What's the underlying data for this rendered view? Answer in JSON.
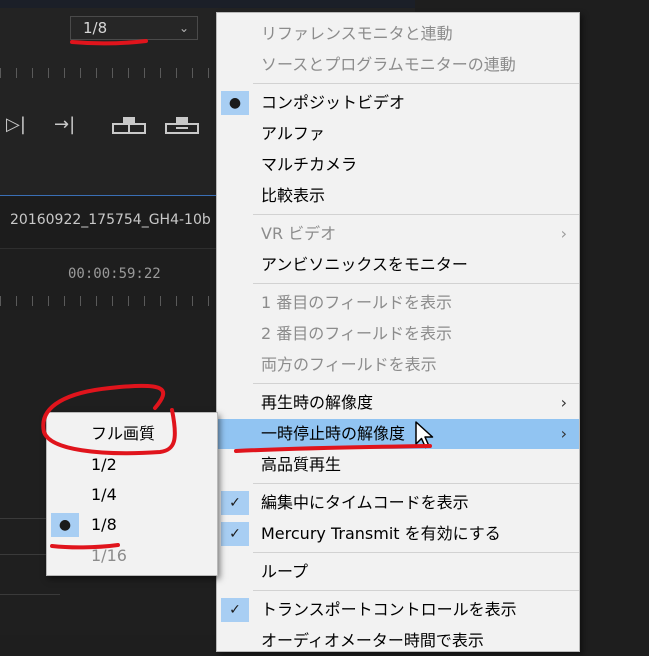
{
  "monitor": {
    "zoom_value": "1/8",
    "clip_name": "20160922_175754_GH4-10b",
    "timecode": "00:00:59:22"
  },
  "context_menu": {
    "items": [
      {
        "label": "リファレンスモニタと連動",
        "disabled": true
      },
      {
        "label": "ソースとプログラムモニターの連動",
        "disabled": true
      },
      {
        "label": "コンポジットビデオ",
        "mark": "●"
      },
      {
        "label": "アルファ"
      },
      {
        "label": "マルチカメラ"
      },
      {
        "label": "比較表示"
      },
      {
        "label": "VR ビデオ",
        "disabled": true,
        "submenu": true
      },
      {
        "label": "アンビソニックスをモニター"
      },
      {
        "label": "1 番目のフィールドを表示",
        "disabled": true
      },
      {
        "label": "2 番目のフィールドを表示",
        "disabled": true
      },
      {
        "label": "両方のフィールドを表示",
        "disabled": true
      },
      {
        "label": "再生時の解像度",
        "submenu": true
      },
      {
        "label": "一時停止時の解像度",
        "submenu": true,
        "highlighted": true
      },
      {
        "label": "高品質再生"
      },
      {
        "label": "編集中にタイムコードを表示",
        "mark": "✓"
      },
      {
        "label": "Mercury Transmit を有効にする",
        "mark": "✓"
      },
      {
        "label": "ループ"
      },
      {
        "label": "トランスポートコントロールを表示",
        "mark": "✓"
      },
      {
        "label": "オーディオメーター時間で表示"
      }
    ]
  },
  "resolution_submenu": {
    "items": [
      {
        "label": "フル画質"
      },
      {
        "label": "1/2"
      },
      {
        "label": "1/4"
      },
      {
        "label": "1/8",
        "mark": "●"
      },
      {
        "label": "1/16",
        "disabled": true
      }
    ]
  },
  "colors": {
    "menu_bg": "#f2f2f2",
    "highlight": "#91c4f2",
    "check_bg": "#a8cef3",
    "annotation_red": "#e0141c",
    "panel_bg": "#232323"
  }
}
